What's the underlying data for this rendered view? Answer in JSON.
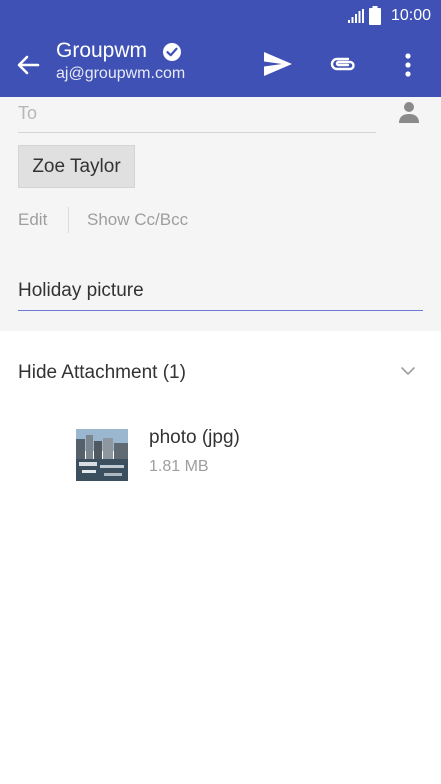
{
  "status_bar": {
    "time": "10:00"
  },
  "app_bar": {
    "account_name": "Groupwm",
    "account_email": "aj@groupwm.com",
    "icons": [
      "back-arrow-icon",
      "verified-check-icon",
      "send-icon",
      "paperclip-icon",
      "more-vert-icon"
    ]
  },
  "compose": {
    "to_label": "To",
    "recipient": "Zoe Taylor",
    "edit_label": "Edit",
    "cc_bcc_label": "Show Cc/Bcc",
    "subject": "Holiday picture"
  },
  "attachments": {
    "header": "Hide Attachment (1)",
    "items": [
      {
        "name": "photo (jpg)",
        "size": "1.81 MB"
      }
    ]
  },
  "colors": {
    "app_bar": "#3f51b5",
    "header_bg": "#f5f5f5",
    "subject_underline": "#6b7bd4"
  }
}
